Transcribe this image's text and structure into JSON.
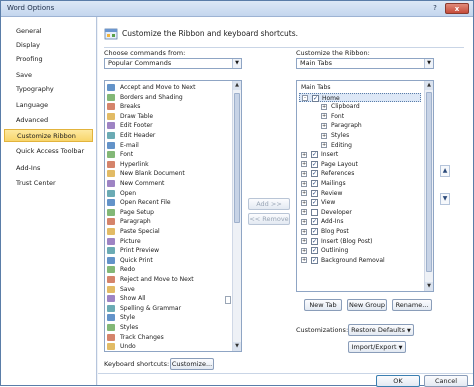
{
  "window": {
    "title": "Word Options",
    "help_glyph": "?",
    "close_glyph": "x"
  },
  "sidebar": {
    "items": [
      {
        "label": "General"
      },
      {
        "label": "Display"
      },
      {
        "label": "Proofing"
      },
      {
        "label": "Save"
      },
      {
        "label": "Typography"
      },
      {
        "label": "Language"
      },
      {
        "label": "Advanced"
      },
      {
        "label": "Customize Ribbon",
        "selected": true
      },
      {
        "label": "Quick Access Toolbar"
      },
      {
        "label": "Add-Ins"
      },
      {
        "label": "Trust Center"
      }
    ]
  },
  "header": {
    "text": "Customize the Ribbon and keyboard shortcuts.",
    "icon": "ribbon-icon"
  },
  "left": {
    "label": "Choose commands from:",
    "combo_value": "Popular Commands",
    "commands": [
      "Accept and Move to Next",
      "Borders and Shading",
      "Breaks",
      "Draw Table",
      "Edit Footer",
      "Edit Header",
      "E-mail",
      "Font",
      "Hyperlink",
      "New Blank Document",
      "New Comment",
      "Open",
      "Open Recent File",
      "Page Setup",
      "Paragraph",
      "Paste Special",
      "Picture",
      "Print Preview",
      "Quick Print",
      "Redo",
      "Reject and Move to Next",
      "Save",
      "Show All",
      "Spelling & Grammar",
      "Style",
      "Styles",
      "Track Changes",
      "Undo"
    ]
  },
  "middle": {
    "add_label": "Add >>",
    "remove_label": "<< Remove"
  },
  "right": {
    "label": "Customize the Ribbon:",
    "combo_value": "Main Tabs",
    "tree": [
      {
        "label": "Main Tabs",
        "level": 0,
        "header": true
      },
      {
        "label": "Home",
        "level": 1,
        "expander": "-",
        "checked": true,
        "selected": true
      },
      {
        "label": "Clipboard",
        "level": 2,
        "expander": "+"
      },
      {
        "label": "Font",
        "level": 2,
        "expander": "+"
      },
      {
        "label": "Paragraph",
        "level": 2,
        "expander": "+"
      },
      {
        "label": "Styles",
        "level": 2,
        "expander": "+"
      },
      {
        "label": "Editing",
        "level": 2,
        "expander": "+"
      },
      {
        "label": "Insert",
        "level": 1,
        "expander": "+",
        "checked": true
      },
      {
        "label": "Page Layout",
        "level": 1,
        "expander": "+",
        "checked": true
      },
      {
        "label": "References",
        "level": 1,
        "expander": "+",
        "checked": true
      },
      {
        "label": "Mailings",
        "level": 1,
        "expander": "+",
        "checked": true
      },
      {
        "label": "Review",
        "level": 1,
        "expander": "+",
        "checked": true
      },
      {
        "label": "View",
        "level": 1,
        "expander": "+",
        "checked": true
      },
      {
        "label": "Developer",
        "level": 1,
        "expander": "+",
        "checked": false
      },
      {
        "label": "Add-Ins",
        "level": 1,
        "expander": "+",
        "checked": true
      },
      {
        "label": "Blog Post",
        "level": 1,
        "expander": "+",
        "checked": true
      },
      {
        "label": "Insert (Blog Post)",
        "level": 1,
        "expander": "+",
        "checked": true
      },
      {
        "label": "Outlining",
        "level": 1,
        "expander": "+",
        "checked": true
      },
      {
        "label": "Background Removal",
        "level": 1,
        "expander": "+",
        "checked": true
      }
    ],
    "new_tab_label": "New Tab",
    "new_group_label": "New Group",
    "rename_label": "Rename...",
    "customizations_label": "Customizations:",
    "restore_defaults_label": "Restore Defaults",
    "import_export_label": "Import/Export"
  },
  "keyboard": {
    "label": "Keyboard shortcuts:",
    "customize_label": "Customize..."
  },
  "footer": {
    "ok_label": "OK",
    "cancel_label": "Cancel"
  },
  "colors": {
    "accent": "#f8d56b",
    "border": "#8fa5c4",
    "icon_blue": "#2f6fb7"
  }
}
